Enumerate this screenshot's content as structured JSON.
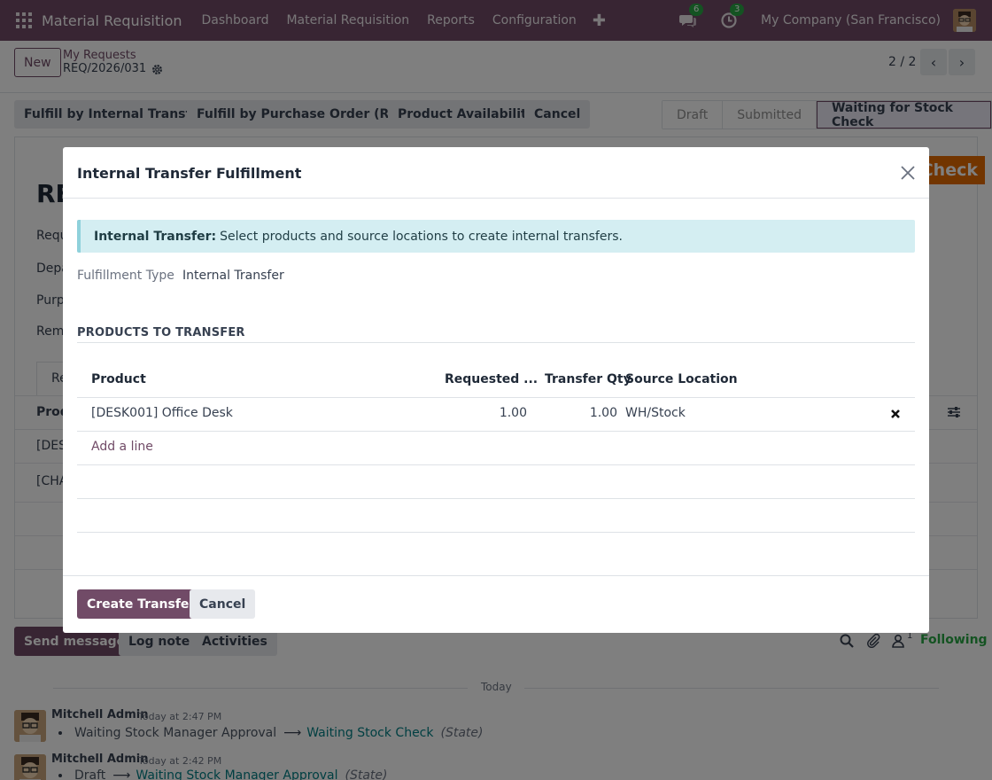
{
  "navbar": {
    "app_name": "Material Requisition",
    "menu": [
      "Dashboard",
      "Material Requisition",
      "Reports",
      "Configuration"
    ],
    "messages_count": "6",
    "activities_count": "3",
    "company": "My Company (San Francisco)",
    "color": "#714b67"
  },
  "control_panel": {
    "new_label": "New",
    "breadcrumb_parent": "My Requests",
    "record_ref": "REQ/2026/031",
    "pager": "2 / 2"
  },
  "actions": {
    "internal_transfer": "Fulfill by Internal Transfer",
    "purchase_order": "Fulfill by Purchase Order (RFQ)",
    "availability": "Product Availability",
    "cancel": "Cancel"
  },
  "statusbar": {
    "stages": [
      "Draft",
      "Submitted",
      "Waiting for Stock Check"
    ],
    "active": "Waiting for Stock Check"
  },
  "background_form": {
    "ribbon": "Check",
    "title_fragment": "RE",
    "labels": [
      "Requ",
      "Depa",
      "Purp",
      "Rem"
    ],
    "tab_fragment": "Re",
    "col_fragment": "Prod",
    "rows": [
      "[DES",
      "[CHA"
    ]
  },
  "chatter": {
    "send_message": "Send message",
    "log_note": "Log note",
    "activities": "Activities",
    "follower_count": "1",
    "following": "Following",
    "today": "Today",
    "messages": [
      {
        "author": "Mitchell Admin",
        "time": "Today at 2:47 PM",
        "old": "Waiting Stock Manager Approval",
        "new": "Waiting Stock Check",
        "field": "(State)"
      },
      {
        "author": "Mitchell Admin",
        "time": "Today at 2:42 PM",
        "old": "Draft",
        "new": "Waiting Stock Manager Approval",
        "field": "(State)"
      }
    ]
  },
  "dialog": {
    "title": "Internal Transfer Fulfillment",
    "alert_title": "Internal Transfer:",
    "alert_text": "Select products and source locations to create internal transfers.",
    "fulfillment_type_label": "Fulfillment Type",
    "fulfillment_type_value": "Internal Transfer",
    "section_title": "PRODUCTS TO TRANSFER",
    "columns": [
      "Product",
      "Requested ...",
      "Transfer Qty",
      "Source Location"
    ],
    "rows": [
      {
        "product": "[DESK001] Office Desk",
        "requested": "1.00",
        "transfer_qty": "1.00",
        "location": "WH/Stock"
      }
    ],
    "add_line": "Add a line",
    "create_button": "Create Transfer",
    "cancel_button": "Cancel"
  }
}
